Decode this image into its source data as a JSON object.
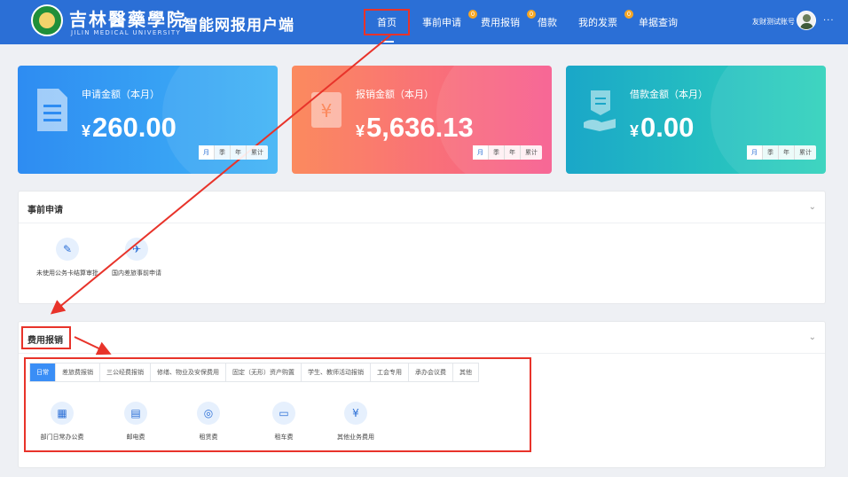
{
  "header": {
    "logo_cn": "吉林醫藥學院",
    "logo_en": "JILIN MEDICAL UNIVERSITY",
    "app_title": "智能网报用户端",
    "nav": [
      {
        "label": "首页",
        "badge": ""
      },
      {
        "label": "事前申请",
        "badge": "0"
      },
      {
        "label": "费用报销",
        "badge": "0"
      },
      {
        "label": "借款",
        "badge": ""
      },
      {
        "label": "我的发票",
        "badge": "0"
      },
      {
        "label": "单据查询",
        "badge": ""
      }
    ],
    "user_name": "友财测试账号",
    "more": "···"
  },
  "cards": [
    {
      "label": "申请金额（本月）",
      "currency": "¥",
      "amount": "260.00",
      "icon": "document-icon"
    },
    {
      "label": "报销金额（本月）",
      "currency": "¥",
      "amount": "5,636.13",
      "icon": "receipt-yen-icon"
    },
    {
      "label": "借款金额（本月）",
      "currency": "¥",
      "amount": "0.00",
      "icon": "hand-bill-icon"
    }
  ],
  "periods": [
    "月",
    "季",
    "年",
    "累计"
  ],
  "pre_panel": {
    "title": "事前申请",
    "tiles": [
      {
        "label": "未使用公务卡结算审批",
        "icon": "approval-doc-icon"
      },
      {
        "label": "国内差旅事前申请",
        "icon": "airplane-icon"
      }
    ]
  },
  "exp_panel": {
    "title": "费用报销",
    "tabs": [
      "日常",
      "差旅费报销",
      "三公经费报销",
      "修缮、物业及安保费用",
      "固定（无形）资产购置",
      "学生、教师活动报销",
      "工会专用",
      "承办会议费",
      "其他"
    ],
    "tiles": [
      {
        "label": "部门日常办公费",
        "icon": "building-icon"
      },
      {
        "label": "邮电费",
        "icon": "mail-doc-icon"
      },
      {
        "label": "租赁费",
        "icon": "lease-icon"
      },
      {
        "label": "租车费",
        "icon": "bus-icon"
      },
      {
        "label": "其他业务费用",
        "icon": "yen-doc-icon"
      }
    ]
  },
  "colors": {
    "header": "#2b6fd6",
    "annotation": "#e8332a",
    "active_tab": "#3a8ef6"
  }
}
